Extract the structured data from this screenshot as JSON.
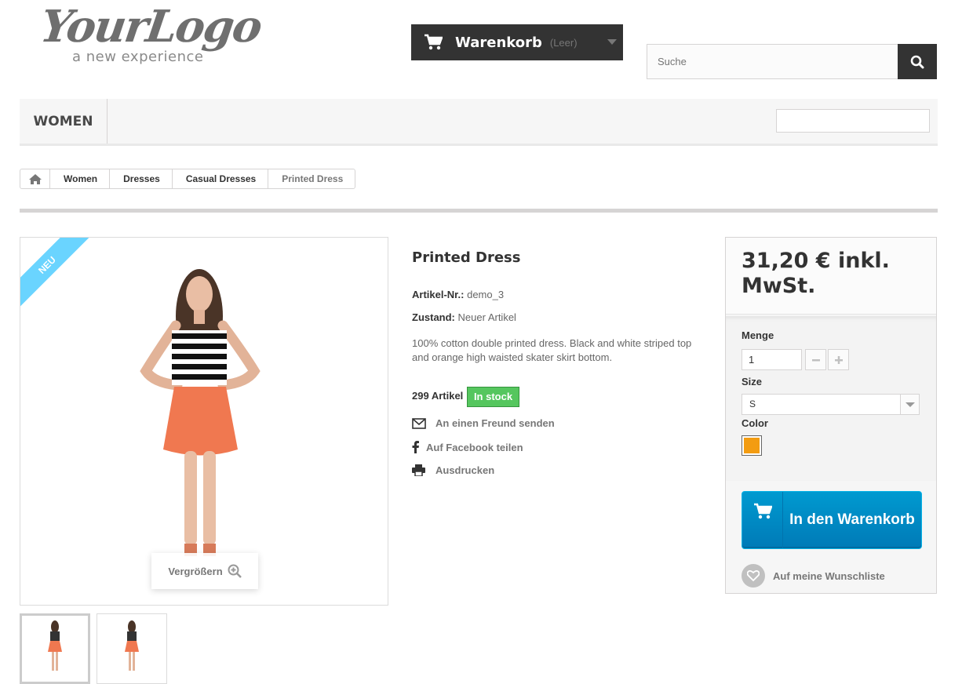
{
  "header": {
    "logo_main": "YourLogo",
    "logo_sub": "a new experience",
    "cart_label": "Warenkorb",
    "cart_status": "(Leer)",
    "search_placeholder": "Suche"
  },
  "menu": {
    "items": [
      {
        "label": "WOMEN"
      }
    ]
  },
  "breadcrumb": {
    "items": [
      {
        "label": "Women"
      },
      {
        "label": "Dresses"
      },
      {
        "label": "Casual Dresses"
      },
      {
        "label": "Printed Dress"
      }
    ]
  },
  "gallery": {
    "ribbon": "NEU",
    "zoom_label": "Vergrößern"
  },
  "product": {
    "title": "Printed Dress",
    "ref_label": "Artikel-Nr.:",
    "ref_value": "demo_3",
    "condition_label": "Zustand:",
    "condition_value": "Neuer Artikel",
    "description": "100% cotton double printed dress. Black and white striped top and orange high waisted skater skirt bottom.",
    "quantity_text": "299 Artikel",
    "availability": "In stock",
    "send_friend": "An einen Freund senden",
    "facebook": "Auf Facebook teilen",
    "print": "Ausdrucken"
  },
  "buy_box": {
    "price": "31,20 € inkl. MwSt.",
    "quantity_label": "Menge",
    "quantity_value": "1",
    "size_label": "Size",
    "size_value": "S",
    "color_label": "Color",
    "color_value": "#f39c11",
    "add_to_cart": "In den Warenkorb",
    "wishlist": "Auf meine Wunschliste"
  },
  "colors": {
    "accent_blue": "#0088c6",
    "in_stock_green": "#55c65e",
    "ribbon_blue": "#6ad4ff",
    "dark": "#333333"
  }
}
